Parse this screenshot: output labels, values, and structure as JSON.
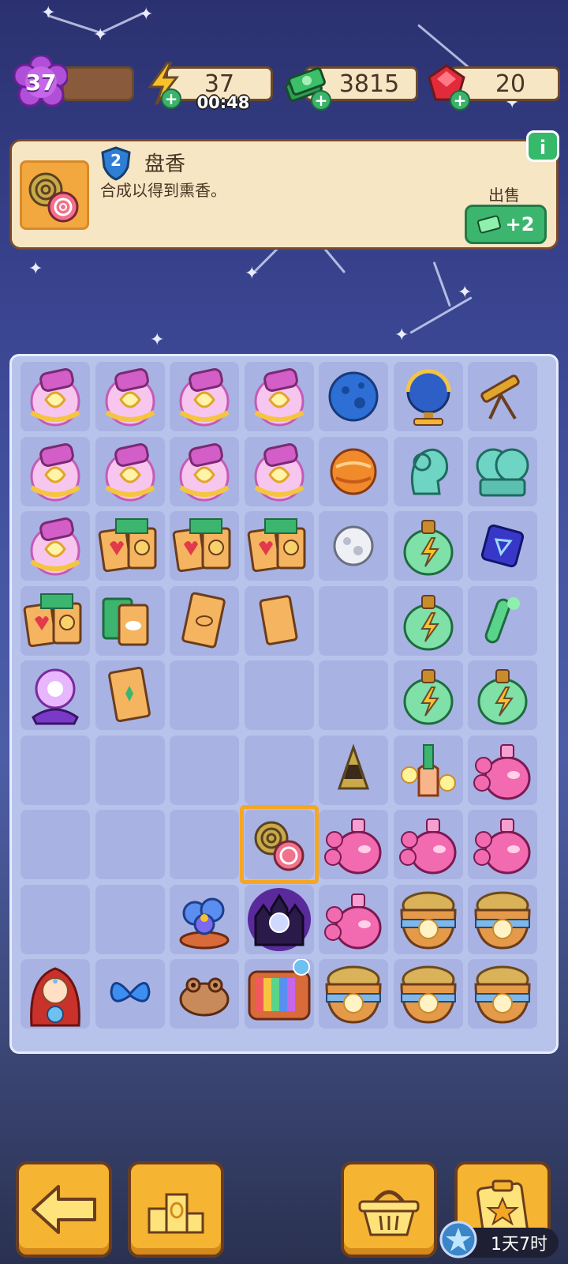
{
  "top_bar": {
    "level": "37",
    "energy": "37",
    "energy_timer": "00:48",
    "cash": "3815",
    "gems": "20"
  },
  "item_info": {
    "level": "2",
    "title": "盘香",
    "description": "合成以得到熏香。",
    "sell_label": "出售",
    "sell_value": "+2"
  },
  "board": {
    "rows": [
      [
        "scroll",
        "scroll",
        "scroll",
        "scroll",
        "blue-planet",
        "celestial-globe",
        "telescope-sextant"
      ],
      [
        "scroll",
        "scroll",
        "scroll",
        "scroll",
        "orange-planet",
        "aries-bust",
        "gemini-bust"
      ],
      [
        "scroll",
        "tarot-fan",
        "tarot-fan",
        "tarot-fan",
        "moon-ball",
        "energy-bottle",
        "rune-stone"
      ],
      [
        "tarot-fan",
        "tarot-cards-cloud",
        "tarot-eye-card",
        "tarot-blank-card",
        "",
        "energy-bottle",
        "potion-tube"
      ],
      [
        "crystal-ball",
        "tarot-single-card",
        "",
        "",
        "",
        "energy-bottle",
        "energy-bottle"
      ],
      [
        "",
        "",
        "",
        "",
        "incense-cone",
        "flower-vial",
        "rose-potion"
      ],
      [
        "",
        "",
        "",
        "incense-coil",
        "rose-potion",
        "rose-potion",
        "rose-potion"
      ],
      [
        "",
        "",
        "blue-flower",
        "haunted-castle",
        "rose-potion",
        "gold-pot",
        "gold-pot"
      ],
      [
        "fortune-teller",
        "blue-butterfly",
        "toad",
        "retro-tv",
        "gold-pot",
        "gold-pot",
        "gold-pot"
      ]
    ],
    "selected": "incense-coil"
  },
  "bottom_bar": {
    "back_label": "back-arrow-icon",
    "event_timer": "1天7时"
  },
  "colors": {
    "accent": "#f5b432",
    "panel": "#f7e6c4",
    "board": "#b8c3ec"
  }
}
